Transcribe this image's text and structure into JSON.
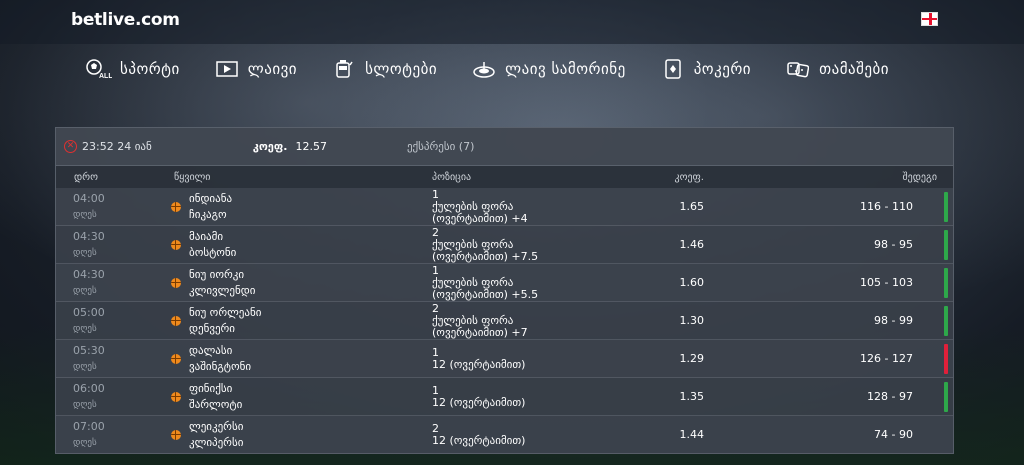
{
  "brand": {
    "logo": "betlive.com"
  },
  "nav": [
    {
      "label": "სპორტი",
      "icon": "soccer-ball-all-icon"
    },
    {
      "label": "ლაივი",
      "icon": "play-icon"
    },
    {
      "label": "სლოტები",
      "icon": "slot-machine-icon"
    },
    {
      "label": "ლაივ სამორინე",
      "icon": "roulette-icon"
    },
    {
      "label": "პოკერი",
      "icon": "poker-card-icon"
    },
    {
      "label": "თამაშები",
      "icon": "dice-icon"
    }
  ],
  "ticket": {
    "date": "23:52 24 იან",
    "odds_label": "კოეფ.",
    "odds_value": "12.57",
    "express": "ექსპრესი (7)"
  },
  "columns": {
    "time": "დრო",
    "event": "წყვილი",
    "position": "პოზიცია",
    "odds": "კოეფ.",
    "result": "შედეგი"
  },
  "rows": [
    {
      "time": "04:00",
      "day": "დღეს",
      "team1": "ინდიანა",
      "team2": "ჩიკაგო",
      "pos1": "1",
      "pos2": "ქულების ფორა",
      "pos3": "(ოვერტაიმით) +4",
      "odds": "1.65",
      "score": "116 - 110",
      "outcome": "win"
    },
    {
      "time": "04:30",
      "day": "დღეს",
      "team1": "მაიამი",
      "team2": "ბოსტონი",
      "pos1": "2",
      "pos2": "ქულების ფორა",
      "pos3": "(ოვერტაიმით) +7.5",
      "odds": "1.46",
      "score": "98 - 95",
      "outcome": "win"
    },
    {
      "time": "04:30",
      "day": "დღეს",
      "team1": "ნიუ იორკი",
      "team2": "კლივლენდი",
      "pos1": "1",
      "pos2": "ქულების ფორა",
      "pos3": "(ოვერტაიმით) +5.5",
      "odds": "1.60",
      "score": "105 - 103",
      "outcome": "win"
    },
    {
      "time": "05:00",
      "day": "დღეს",
      "team1": "ნიუ ორლეანი",
      "team2": "დენვერი",
      "pos1": "2",
      "pos2": "ქულების ფორა",
      "pos3": "(ოვერტაიმით) +7",
      "odds": "1.30",
      "score": "98 - 99",
      "outcome": "win"
    },
    {
      "time": "05:30",
      "day": "დღეს",
      "team1": "დალასი",
      "team2": "ვაშინგტონი",
      "pos1": "1",
      "pos2": "12 (ოვერტაიმით)",
      "pos3": "",
      "odds": "1.29",
      "score": "126 - 127",
      "outcome": "loss"
    },
    {
      "time": "06:00",
      "day": "დღეს",
      "team1": "ფინიქსი",
      "team2": "შარლოტი",
      "pos1": "1",
      "pos2": "12 (ოვერტაიმით)",
      "pos3": "",
      "odds": "1.35",
      "score": "128 - 97",
      "outcome": "win"
    },
    {
      "time": "07:00",
      "day": "დღეს",
      "team1": "ლეიკერსი",
      "team2": "კლიპერსი",
      "pos1": "2",
      "pos2": "12 (ოვერტაიმით)",
      "pos3": "",
      "odds": "1.44",
      "score": "74 - 90",
      "outcome": "none"
    }
  ],
  "colors": {
    "win": "#2ea84a",
    "loss": "#e0203a",
    "ball": "#f08a1c"
  }
}
